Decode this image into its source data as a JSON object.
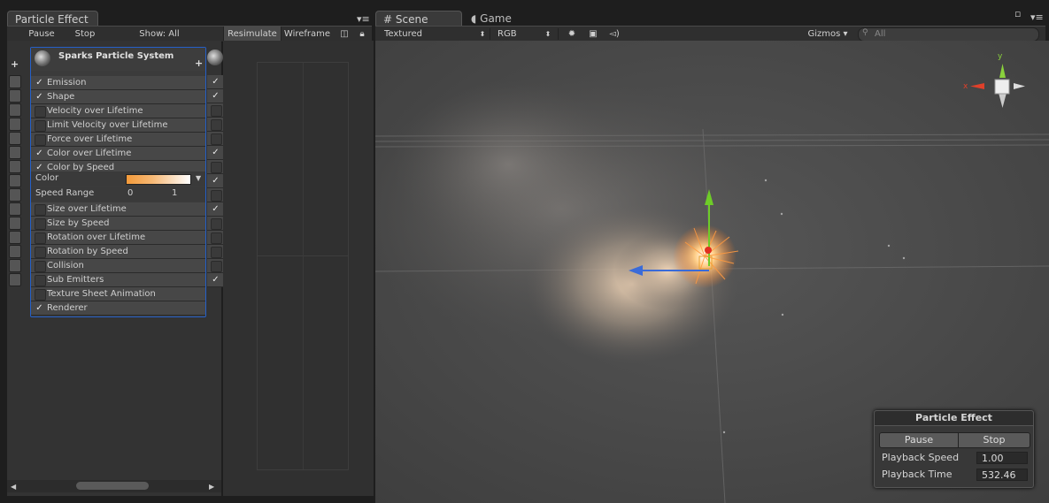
{
  "particle_panel": {
    "tab_title": "Particle Effect",
    "toolbar": {
      "pause": "Pause",
      "stop": "Stop",
      "show": "Show: All",
      "resimulate": "Resimulate",
      "wireframe": "Wireframe"
    },
    "system_name": "Sparks Particle System",
    "modules": [
      {
        "label": "Emission",
        "checked": true
      },
      {
        "label": "Shape",
        "checked": true
      },
      {
        "label": "Velocity over Lifetime",
        "checked": false
      },
      {
        "label": "Limit Velocity over Lifetime",
        "checked": false
      },
      {
        "label": "Force over Lifetime",
        "checked": false
      },
      {
        "label": "Color over Lifetime",
        "checked": true
      },
      {
        "label": "Color by Speed",
        "checked": true
      }
    ],
    "color_label": "Color",
    "speed_range_label": "Speed Range",
    "speed_range_min": "0",
    "speed_range_max": "1",
    "modules_after": [
      {
        "label": "Size over Lifetime",
        "checked": false
      },
      {
        "label": "Size by Speed",
        "checked": false
      },
      {
        "label": "Rotation over Lifetime",
        "checked": false
      },
      {
        "label": "Rotation by Speed",
        "checked": false
      },
      {
        "label": "Collision",
        "checked": false
      },
      {
        "label": "Sub Emitters",
        "checked": false
      },
      {
        "label": "Texture Sheet Animation",
        "checked": false
      },
      {
        "label": "Renderer",
        "checked": true
      }
    ],
    "check_glyph": "✓",
    "add_glyph": "+"
  },
  "scene_panel": {
    "scene_tab": "Scene",
    "game_tab": "Game",
    "toolbar": {
      "render_mode": "Textured",
      "color_mode": "RGB",
      "gizmos": "Gizmos",
      "search_placeholder": "All"
    },
    "gizmo": {
      "x_label": "x",
      "y_label": "y"
    }
  },
  "overlay": {
    "title": "Particle Effect",
    "pause": "Pause",
    "stop": "Stop",
    "playback_speed_label": "Playback Speed",
    "playback_speed_value": "1.00",
    "playback_time_label": "Playback Time",
    "playback_time_value": "532.46"
  },
  "colors": {
    "selection_blue": "#2560c8",
    "gradient_start": "#f39a3a",
    "gradient_end": "#ffffff"
  }
}
